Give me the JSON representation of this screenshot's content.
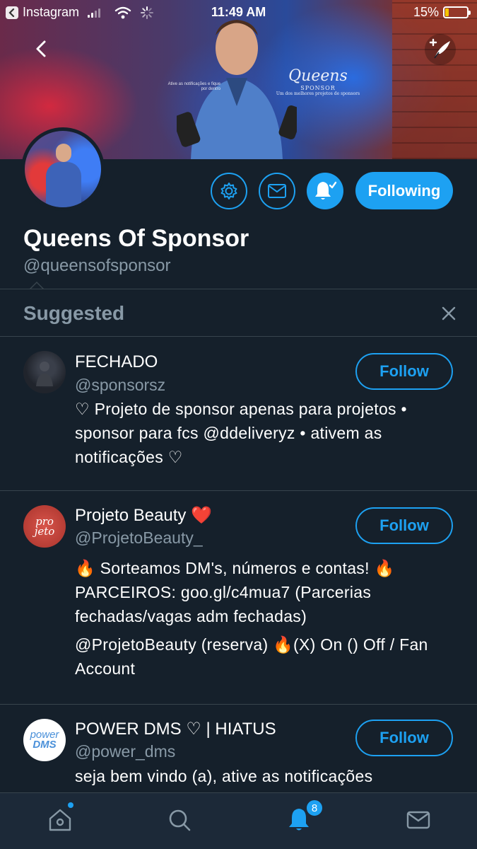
{
  "status_bar": {
    "carrier": "Instagram",
    "time": "11:49 AM",
    "battery": "15%",
    "battery_level": 0.15
  },
  "banner": {
    "signature_script": "Queens",
    "signature_word": "SPONSOR",
    "signature_tagline": "Um dos melhores projetos de sponsors",
    "note": "Ative as notificações e fique por dentro"
  },
  "profile": {
    "display_name": "Queens Of Sponsor",
    "handle": "@queensofsponsor",
    "following_label": "Following"
  },
  "suggested": {
    "title": "Suggested",
    "items": [
      {
        "name": "FECHADO",
        "handle": "@sponsorsz",
        "bio": "♡ Projeto de sponsor apenas para projetos • sponsor para fcs @ddeliveryz • ativem as notificações ♡",
        "follow_label": "Follow"
      },
      {
        "name": "Projeto Beauty ❤️",
        "handle": "@ProjetoBeauty_",
        "bio_line1": "🔥 Sorteamos DM's, números e contas! 🔥 PARCEIROS: goo.gl/c4mua7 (Parcerias fechadas/vagas adm fechadas)",
        "bio_line2": "@ProjetoBeauty (reserva) 🔥(X) On () Off / Fan Account",
        "avatar_text": "pro jeto",
        "follow_label": "Follow"
      },
      {
        "name": "POWER DMS ♡ | HIATUS",
        "handle": "@power_dms",
        "bio": "seja bem vindo (a), ative as notificações",
        "avatar_text_top": "power",
        "avatar_text_bottom": "DMS",
        "follow_label": "Follow"
      }
    ]
  },
  "tabbar": {
    "notifications_badge": "8"
  },
  "colors": {
    "background": "#15202b",
    "accent": "#1da1f2",
    "secondary_text": "#8899a6",
    "divider": "#38444d",
    "tabbar": "#1c2938"
  }
}
